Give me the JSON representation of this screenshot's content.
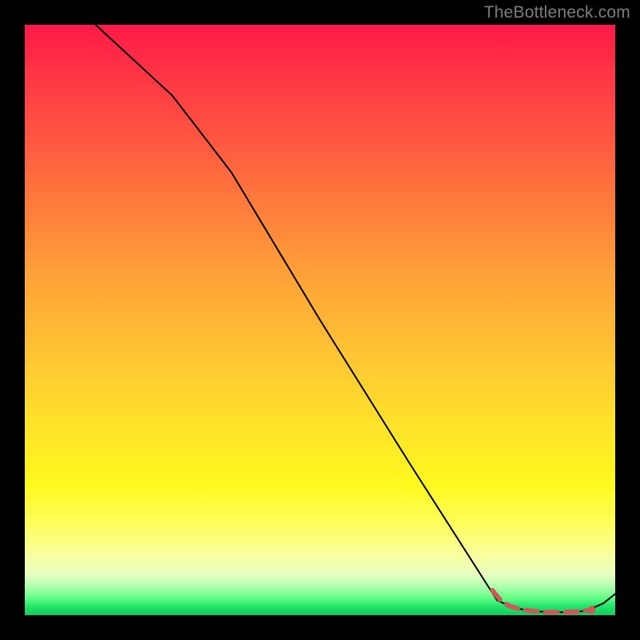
{
  "watermark": "TheBottleneck.com",
  "chart_data": {
    "type": "line",
    "title": "",
    "xlabel": "",
    "ylabel": "",
    "xlim": [
      0,
      100
    ],
    "ylim": [
      0,
      100
    ],
    "series": [
      {
        "name": "black-curve",
        "stroke": "#000000",
        "stroke_width": 2,
        "x": [
          0,
          12,
          25,
          35,
          50,
          65,
          80,
          83,
          86,
          89,
          92,
          95,
          98,
          100
        ],
        "y": [
          110,
          100,
          88,
          75,
          50,
          26,
          2.5,
          1.2,
          0.7,
          0.5,
          0.5,
          0.7,
          2.0,
          3.6
        ]
      },
      {
        "name": "red-highlight-dashes",
        "stroke": "#cb5a5a",
        "stroke_width": 6,
        "dash": true,
        "x": [
          79.2,
          80.5,
          82.0,
          83.8,
          86.0,
          88.5,
          91.0,
          93.5,
          96.0
        ],
        "y": [
          4.2,
          2.6,
          1.6,
          1.0,
          0.7,
          0.5,
          0.5,
          0.6,
          0.9
        ]
      },
      {
        "name": "red-end-dot",
        "type": "scatter",
        "fill": "#cb5a5a",
        "x": [
          96.0
        ],
        "y": [
          0.9
        ],
        "r": 4
      }
    ],
    "gradient_stops": [
      {
        "pos": 0.0,
        "color": "#ff1a47"
      },
      {
        "pos": 0.3,
        "color": "#ff7a3c"
      },
      {
        "pos": 0.55,
        "color": "#ffc234"
      },
      {
        "pos": 0.78,
        "color": "#fff81e"
      },
      {
        "pos": 0.93,
        "color": "#e8ffc0"
      },
      {
        "pos": 1.0,
        "color": "#14c95e"
      }
    ]
  }
}
